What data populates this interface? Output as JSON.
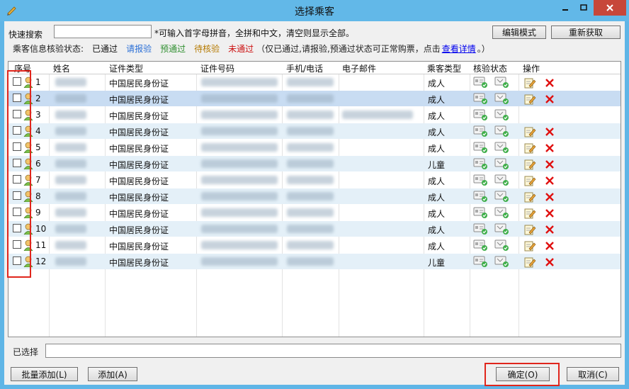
{
  "window": {
    "title": "选择乘客"
  },
  "toolbar": {
    "search_label": "快速搜索",
    "search_value": "",
    "hint": "*可输入首字母拼音，全拼和中文，清空则显示全部。",
    "edit_mode": "编辑模式",
    "refresh": "重新获取"
  },
  "status_legend": {
    "label": "乘客信息核验状态:",
    "passed": "已通过",
    "pending_report": "请报验",
    "pre_passed": "预通过",
    "awaiting": "待核验",
    "not_passed": "未通过",
    "note_prefix": "（仅已通过,请报验,预通过状态可正常购票，点击",
    "note_link": "查看详情",
    "note_suffix": "。）",
    "colors": {
      "passed": "#111111",
      "pending_report": "#2a6fd6",
      "pre_passed": "#2f8f2f",
      "awaiting": "#b57a00",
      "not_passed": "#cc1111"
    }
  },
  "table": {
    "columns": [
      "序号",
      "姓名",
      "证件类型",
      "证件号码",
      "手机/电话",
      "电子邮件",
      "乘客类型",
      "核验状态",
      "操作"
    ],
    "rows": [
      {
        "no": "1",
        "id_type": "中国居民身份证",
        "passenger_type": "成人",
        "ops": true
      },
      {
        "no": "2",
        "id_type": "中国居民身份证",
        "passenger_type": "成人",
        "ops": true
      },
      {
        "no": "3",
        "id_type": "中国居民身份证",
        "passenger_type": "成人",
        "ops": false
      },
      {
        "no": "4",
        "id_type": "中国居民身份证",
        "passenger_type": "成人",
        "ops": true
      },
      {
        "no": "5",
        "id_type": "中国居民身份证",
        "passenger_type": "成人",
        "ops": true
      },
      {
        "no": "6",
        "id_type": "中国居民身份证",
        "passenger_type": "儿童",
        "ops": true
      },
      {
        "no": "7",
        "id_type": "中国居民身份证",
        "passenger_type": "成人",
        "ops": true
      },
      {
        "no": "8",
        "id_type": "中国居民身份证",
        "passenger_type": "成人",
        "ops": true
      },
      {
        "no": "9",
        "id_type": "中国居民身份证",
        "passenger_type": "成人",
        "ops": true
      },
      {
        "no": "10",
        "id_type": "中国居民身份证",
        "passenger_type": "成人",
        "ops": true
      },
      {
        "no": "11",
        "id_type": "中国居民身份证",
        "passenger_type": "成人",
        "ops": true
      },
      {
        "no": "12",
        "id_type": "中国居民身份证",
        "passenger_type": "儿童",
        "ops": true
      }
    ]
  },
  "footer": {
    "selected_label": "已选择",
    "selected_value": "",
    "batch_add": "批量添加(L)",
    "add": "添加(A)",
    "ok": "确定(O)",
    "cancel": "取消(C)"
  }
}
